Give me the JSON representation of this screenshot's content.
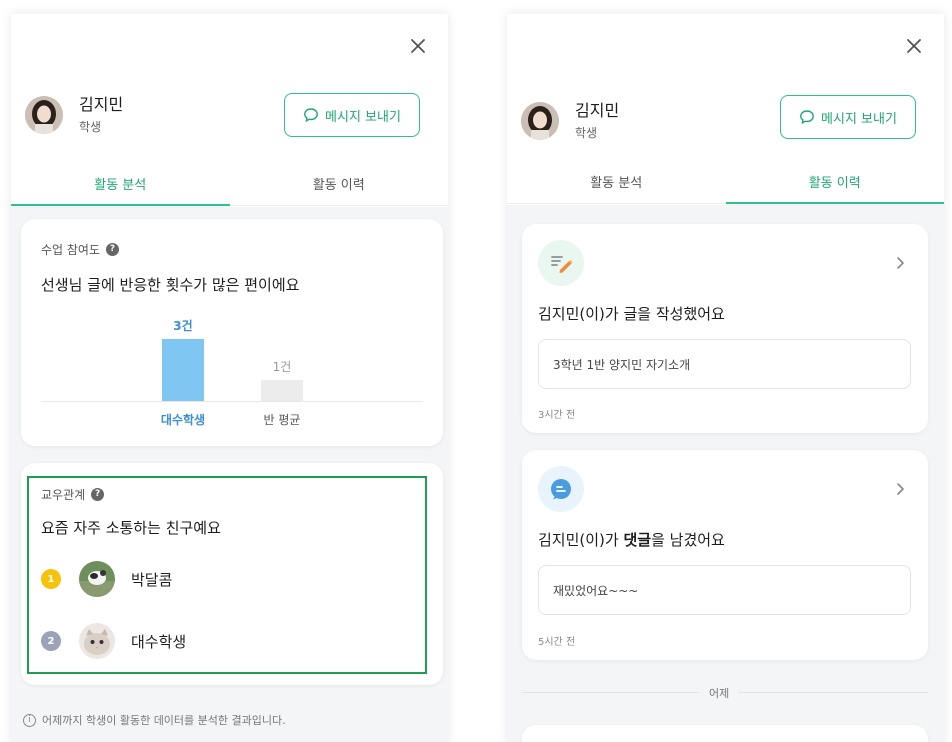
{
  "left_panel": {
    "profile": {
      "name": "김지민",
      "role": "학생"
    },
    "message_button": "메시지 보내기",
    "tabs": [
      {
        "label": "활동 분석",
        "active": true
      },
      {
        "label": "활동 이력",
        "active": false
      }
    ],
    "participation": {
      "title": "수업 참여도",
      "headline": "선생님 글에 반응한 횟수가 많은 편이에요",
      "chart_data": {
        "type": "bar",
        "categories": [
          "대수학생",
          "반 평균"
        ],
        "values": [
          3,
          1
        ],
        "value_labels": [
          "3건",
          "1건"
        ],
        "colors": [
          "#7fc6f3",
          "#ececec"
        ],
        "label_colors": [
          "#3b8fd6",
          "#999999"
        ],
        "ylim": [
          0,
          3
        ]
      }
    },
    "relations": {
      "title": "교우관계",
      "headline": "요즘 자주 소통하는 친구예요",
      "friends": [
        {
          "rank": "1",
          "name": "박달콤",
          "rank_color": "#f6c20a"
        },
        {
          "rank": "2",
          "name": "대수학생",
          "rank_color": "#9aa3b8"
        }
      ]
    },
    "footer_note": "어제까지 학생이 활동한 데이터를 분석한 결과입니다."
  },
  "right_panel": {
    "profile": {
      "name": "김지민",
      "role": "학생"
    },
    "message_button": "메시지 보내기",
    "tabs": [
      {
        "label": "활동 분석",
        "active": false
      },
      {
        "label": "활동 이력",
        "active": true
      }
    ],
    "activities": [
      {
        "icon": "pencil-note-icon",
        "title": "김지민(이)가 글을 작성했어요",
        "content": "3학년 1반 양지민 자기소개",
        "time": "3시간 전"
      },
      {
        "icon": "comment-bubble-icon",
        "title_prefix": "김지민(이)가 ",
        "title_bold": "댓글",
        "title_suffix": "을 남겼어요",
        "content": "재밌었어요~~~",
        "time": "5시간 전"
      }
    ],
    "day_separator": "어제"
  },
  "colors": {
    "accent_green": "#2ec28d",
    "highlight_border": "#1f9d55",
    "bar_blue": "#7fc6f3"
  }
}
